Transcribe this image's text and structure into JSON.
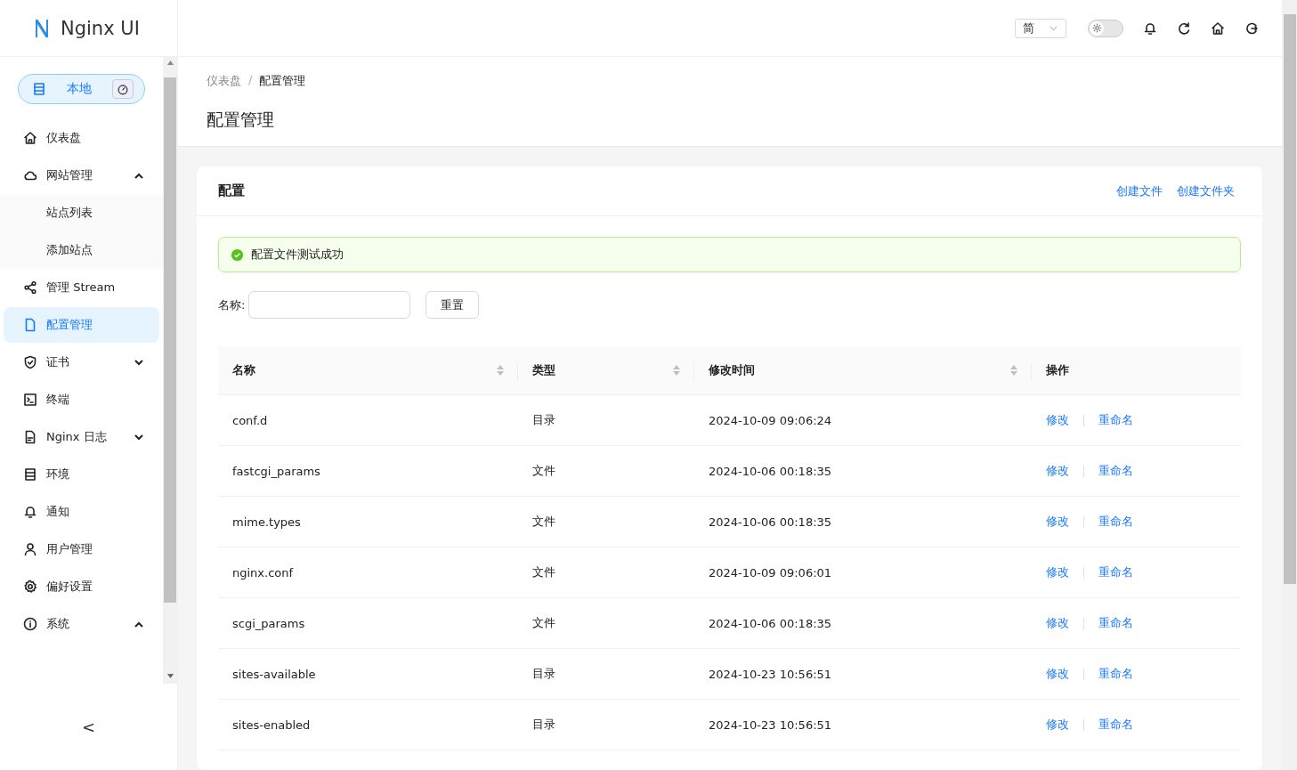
{
  "logo": {
    "text": "Nginx UI"
  },
  "environment": {
    "label": "本地"
  },
  "sidebar": {
    "items": [
      {
        "label": "仪表盘",
        "selected": false
      },
      {
        "label": "网站管理",
        "selected": false,
        "expanded": true,
        "children": [
          {
            "label": "站点列表",
            "selected": false
          },
          {
            "label": "添加站点",
            "selected": false
          }
        ]
      },
      {
        "label": "管理 Stream",
        "selected": false
      },
      {
        "label": "配置管理",
        "selected": true
      },
      {
        "label": "证书",
        "selected": false,
        "expanded": false
      },
      {
        "label": "终端",
        "selected": false
      },
      {
        "label": "Nginx 日志",
        "selected": false,
        "expanded": false
      },
      {
        "label": "环境",
        "selected": false
      },
      {
        "label": "通知",
        "selected": false
      },
      {
        "label": "用户管理",
        "selected": false
      },
      {
        "label": "偏好设置",
        "selected": false
      },
      {
        "label": "系统",
        "selected": false,
        "expanded": true
      }
    ],
    "collapse_button": "<"
  },
  "header": {
    "language": "简",
    "theme_toggle": {
      "on": false
    }
  },
  "breadcrumb": {
    "items": [
      "仪表盘",
      "配置管理"
    ],
    "separator": "/"
  },
  "page_title": "配置管理",
  "card": {
    "title": "配置",
    "actions": [
      "创建文件",
      "创建文件夹"
    ],
    "alert": {
      "kind": "success",
      "text": "配置文件测试成功"
    },
    "filter": {
      "label": "名称:"
    },
    "reset_button": "重置",
    "table": {
      "columns": [
        {
          "label": "名称",
          "sortable": true
        },
        {
          "label": "类型",
          "sortable": true
        },
        {
          "label": "修改时间",
          "sortable": true
        },
        {
          "label": "操作",
          "sortable": false
        }
      ],
      "rows": [
        {
          "name": "conf.d",
          "type": "目录",
          "modified": "2024-10-09 09:06:24",
          "actions": [
            "修改",
            "重命名"
          ]
        },
        {
          "name": "fastcgi_params",
          "type": "文件",
          "modified": "2024-10-06 00:18:35",
          "actions": [
            "修改",
            "重命名"
          ]
        },
        {
          "name": "mime.types",
          "type": "文件",
          "modified": "2024-10-06 00:18:35",
          "actions": [
            "修改",
            "重命名"
          ]
        },
        {
          "name": "nginx.conf",
          "type": "文件",
          "modified": "2024-10-09 09:06:01",
          "actions": [
            "修改",
            "重命名"
          ]
        },
        {
          "name": "scgi_params",
          "type": "文件",
          "modified": "2024-10-06 00:18:35",
          "actions": [
            "修改",
            "重命名"
          ]
        },
        {
          "name": "sites-available",
          "type": "目录",
          "modified": "2024-10-23 10:56:51",
          "actions": [
            "修改",
            "重命名"
          ]
        },
        {
          "name": "sites-enabled",
          "type": "目录",
          "modified": "2024-10-23 10:56:51",
          "actions": [
            "修改",
            "重命名"
          ]
        }
      ]
    }
  }
}
